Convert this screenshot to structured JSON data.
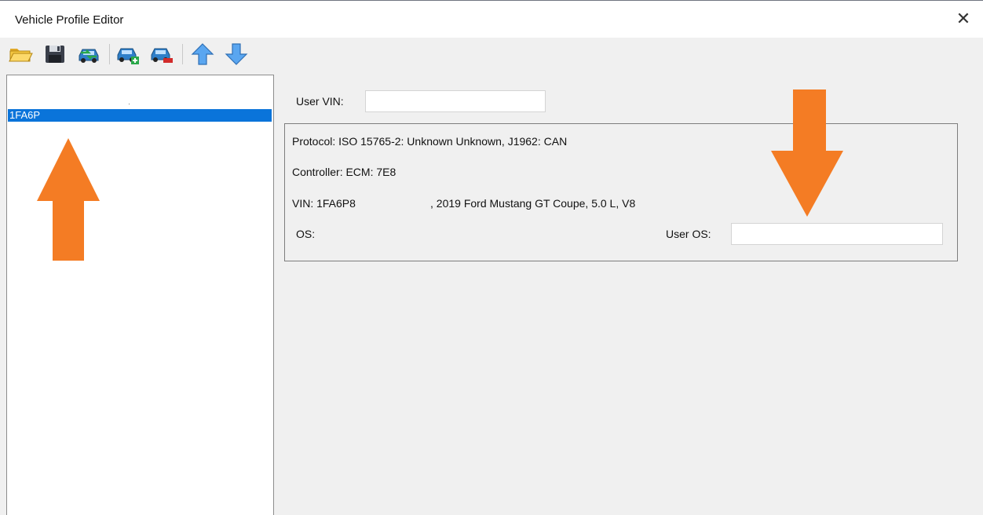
{
  "window": {
    "title": "Vehicle Profile Editor",
    "close_glyph": "✕"
  },
  "toolbar": {
    "buttons": [
      {
        "name": "open-folder-icon",
        "tooltip": ""
      },
      {
        "name": "save-icon",
        "tooltip": ""
      },
      {
        "name": "car-transfer-icon",
        "tooltip": ""
      },
      {
        "name": "car-add-icon",
        "tooltip": ""
      },
      {
        "name": "car-remove-icon",
        "tooltip": ""
      },
      {
        "name": "arrow-up-icon",
        "tooltip": ""
      },
      {
        "name": "arrow-down-icon",
        "tooltip": ""
      }
    ]
  },
  "profiles": {
    "items": [
      {
        "label": "1FA6P",
        "selected": true
      }
    ]
  },
  "details": {
    "user_vin_label": "User VIN:",
    "user_vin_value": "",
    "protocol": "Protocol: ISO 15765-2: Unknown Unknown, J1962: CAN",
    "controller": "Controller: ECM: 7E8",
    "vin_prefix": "VIN: 1FA6P8",
    "vin_suffix": ", 2019 Ford Mustang GT Coupe, 5.0 L, V8",
    "os_label": "OS:",
    "user_os_label": "User OS:",
    "user_os_value": ""
  },
  "annotations": {
    "arrow_color": "#f47c24"
  },
  "colors": {
    "selection": "#0a74da"
  }
}
